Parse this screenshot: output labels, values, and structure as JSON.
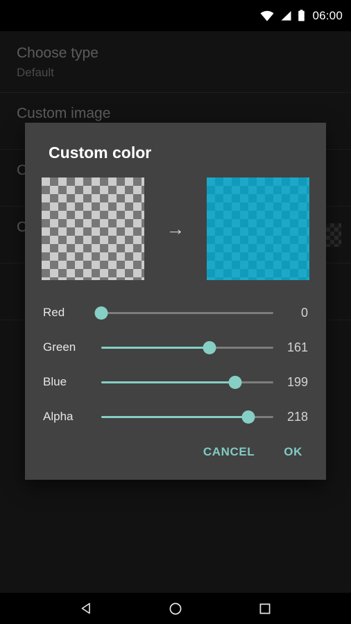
{
  "status_bar": {
    "time": "06:00",
    "icons": [
      "wifi-icon",
      "cell-signal-icon",
      "battery-icon"
    ]
  },
  "background_screen": {
    "rows": [
      {
        "title": "Choose type",
        "subtitle": "Default",
        "has_swatch": false
      },
      {
        "title": "Custom image",
        "subtitle": "",
        "has_swatch": false
      },
      {
        "title": "C",
        "subtitle": "",
        "has_swatch": false
      },
      {
        "title": "C",
        "subtitle": "",
        "has_swatch": true
      }
    ]
  },
  "dialog": {
    "title": "Custom color",
    "preview": {
      "old_label": "old-color-swatch",
      "new_label": "new-color-swatch",
      "arrow_glyph": "→",
      "old_color_css": "rgba(0,0,0,0)",
      "new_color_css": "rgba(0,161,199,0.855)"
    },
    "sliders": [
      {
        "label": "Red",
        "value": 0,
        "max": 255,
        "percent": 0.0
      },
      {
        "label": "Green",
        "value": 161,
        "max": 255,
        "percent": 63.1
      },
      {
        "label": "Blue",
        "value": 199,
        "max": 255,
        "percent": 78.0
      },
      {
        "label": "Alpha",
        "value": 218,
        "max": 255,
        "percent": 85.5
      }
    ],
    "buttons": {
      "cancel": "CANCEL",
      "ok": "OK"
    },
    "colors": {
      "accent": "#80cbc4",
      "slider_fill": "#86cfc4",
      "slider_track": "#7d7d7d",
      "dialog_bg": "#424242",
      "preview_new": "#00a1c7"
    }
  },
  "nav_bar": {
    "back": "back-nav-button",
    "home": "home-nav-button",
    "recents": "recents-nav-button"
  }
}
